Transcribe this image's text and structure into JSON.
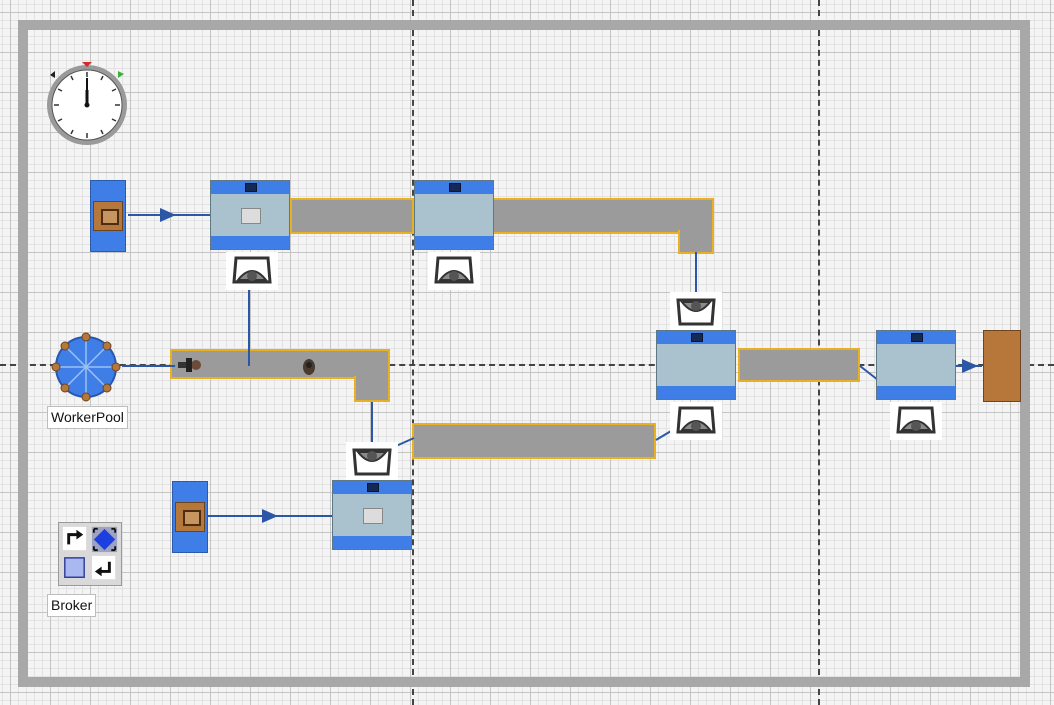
{
  "window": {},
  "labels": {
    "worker_pool": "WorkerPool",
    "broker": "Broker"
  },
  "colors": {
    "grid_background": "#f4f4f4",
    "frame": "#a8a8a8",
    "processor_band": "#3e7ee6",
    "processor_body": "#a9c2cd",
    "conveyor": "#9b9b9b",
    "conveyor_edge": "#e8b023",
    "connector": "#2c56a6",
    "sink": "#b8773a"
  },
  "objects": {
    "sources": [
      "source-icon",
      "source-icon"
    ],
    "processors": [
      "processor-icon",
      "processor-icon",
      "processor-icon",
      "processor-icon",
      "processor-icon"
    ],
    "operators": [
      "operator-icon",
      "operator-icon",
      "operator-icon",
      "operator-icon",
      "operator-icon",
      "operator-icon",
      "operator-icon"
    ],
    "conveyors": [
      "conveyor",
      "conveyor",
      "conveyor",
      "conveyor"
    ],
    "sink": "sink-icon",
    "worker_pool": "worker-pool-icon",
    "broker": "broker-icon",
    "clock": "clock-icon"
  }
}
